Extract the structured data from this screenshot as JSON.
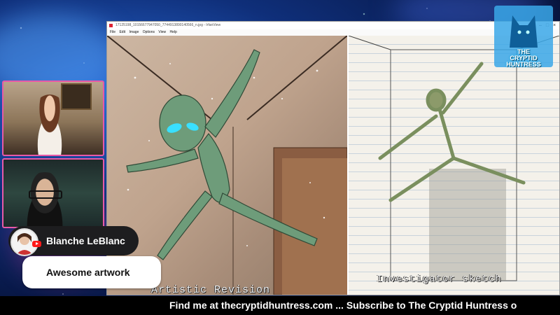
{
  "viewer": {
    "title": "17125198_10156677947050_7744913890140566_n.jpg - IrfanView",
    "menu": [
      "File",
      "Edit",
      "Image",
      "Options",
      "View",
      "Help"
    ],
    "captions": {
      "left": "Artistic Revision",
      "right": "Investigator sketch"
    }
  },
  "logo": {
    "line1": "THE",
    "line2": "CRYPTID",
    "line3": "HUNTRESS"
  },
  "chat": {
    "name": "Blanche LeBlanc",
    "message": "Awesome artwork"
  },
  "ticker": {
    "text": "Find me at thecryptidhuntress.com ... Subscribe to The Cryptid Huntress o"
  },
  "colors": {
    "accent_pink": "#e85aa6",
    "youtube_red": "#ff1a1a",
    "alien_green": "#6e9c7a",
    "eye_cyan": "#39e0ff"
  }
}
